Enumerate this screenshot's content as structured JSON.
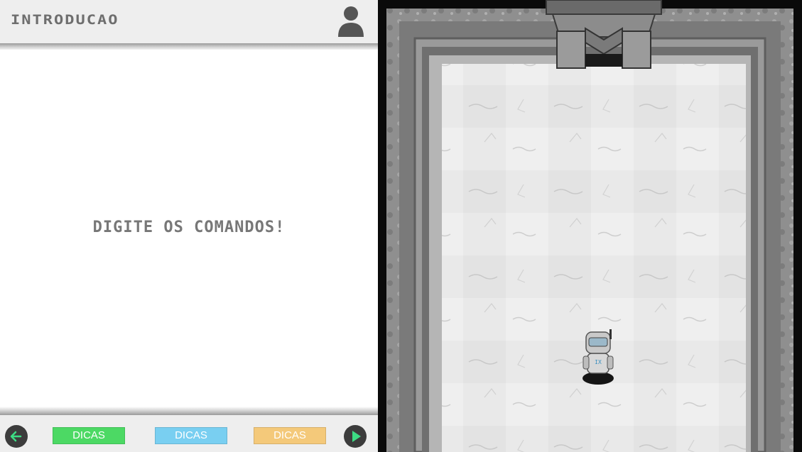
{
  "header": {
    "level_title": "INTRODUCAO",
    "profile_icon": "user-icon"
  },
  "main": {
    "message": "DIGITE OS COMANDOS!"
  },
  "footer": {
    "back_icon": "arrow-left-icon",
    "play_icon": "play-icon",
    "hint_buttons": [
      {
        "label": "DICAS",
        "color": "#4cd964"
      },
      {
        "label": "DICAS",
        "color": "#79cff1"
      },
      {
        "label": "DICAS",
        "color": "#f4c97a"
      }
    ],
    "back_icon_color": "#3ddc84",
    "play_icon_color": "#3ddc84"
  },
  "game": {
    "character_icon": "robot-character-icon",
    "robot_label": "IX"
  },
  "colors": {
    "title_text": "#6e6e6e",
    "bar_background": "#eeeeee",
    "arena_floor": "#e8e8e8",
    "arena_wall": "#8a8a8a"
  }
}
